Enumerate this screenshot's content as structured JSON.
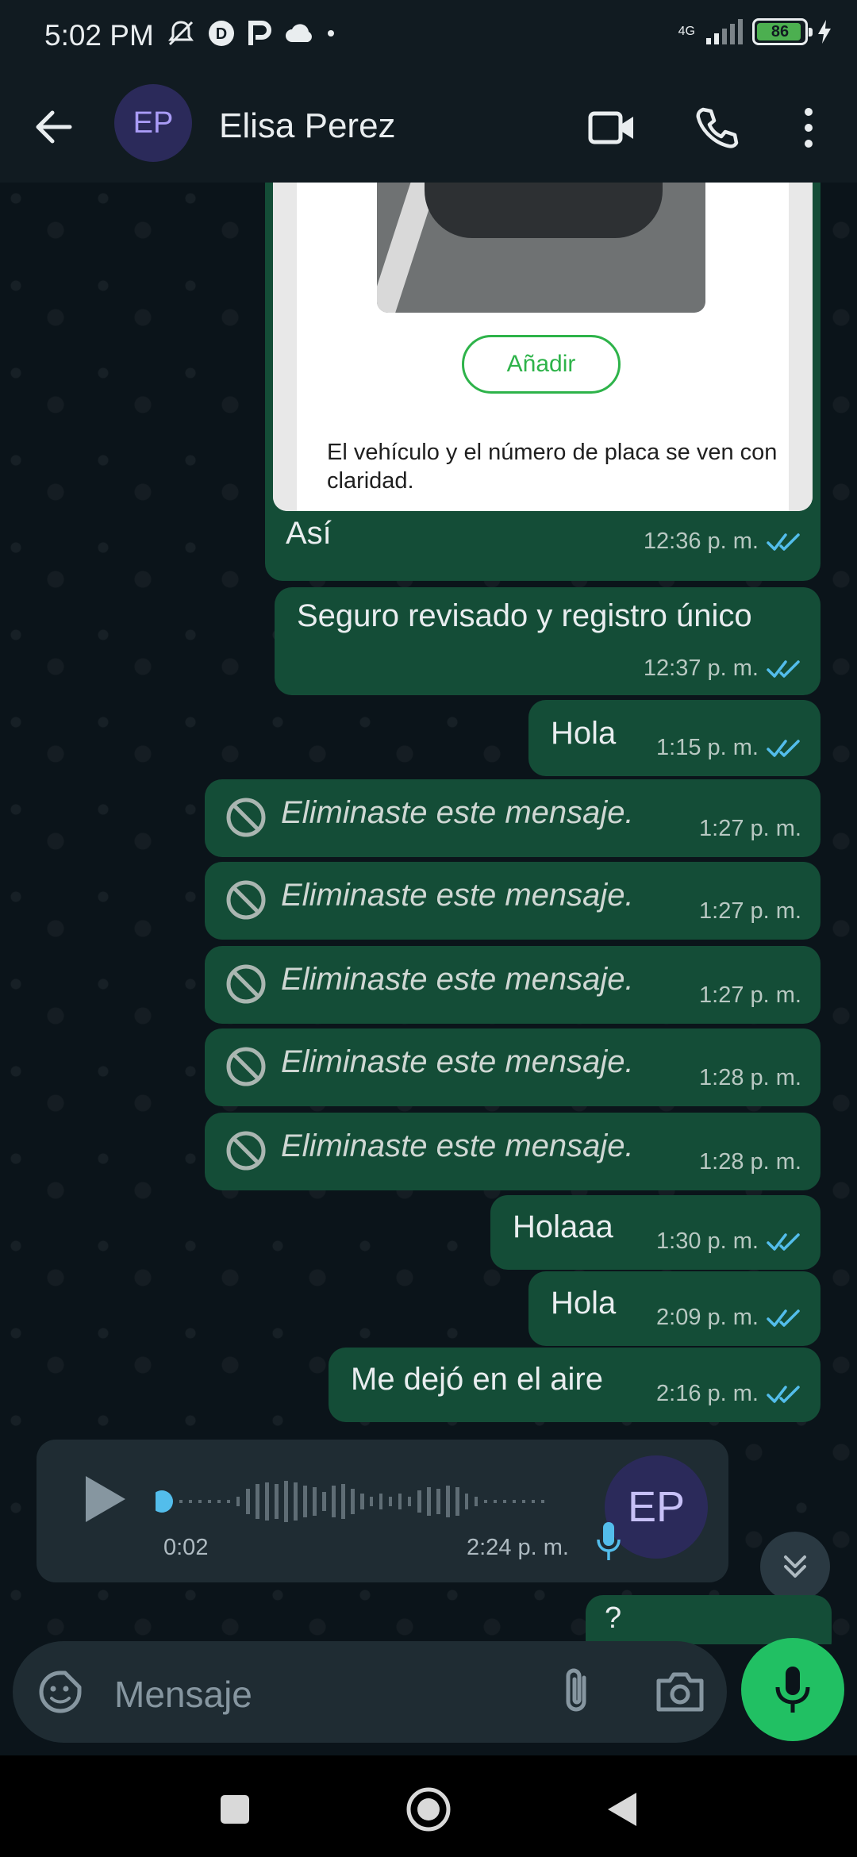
{
  "status_bar": {
    "time": "5:02 PM",
    "network": "4G",
    "battery": "86",
    "icons": [
      "mute-bell-icon",
      "d-icon",
      "p-icon",
      "cloud-icon",
      "dot-icon",
      "signal-icon",
      "battery-icon",
      "charging-icon"
    ]
  },
  "header": {
    "avatar_initials": "EP",
    "contact_name": "Elisa Perez",
    "icons": [
      "back-arrow-icon",
      "video-call-icon",
      "phone-call-icon",
      "more-vert-icon"
    ]
  },
  "card": {
    "button_label": "Añadir",
    "caption": "El vehículo y el número de placa se ven con claridad."
  },
  "messages": [
    {
      "text": "Así",
      "time": "12:36 p. m.",
      "read": true
    },
    {
      "text": "Seguro revisado y registro único",
      "time": "12:37 p. m.",
      "read": true
    },
    {
      "text": "Hola",
      "time": "1:15 p. m.",
      "read": true
    },
    {
      "text": "Eliminaste este mensaje.",
      "time": "1:27 p. m.",
      "deleted": true
    },
    {
      "text": "Eliminaste este mensaje.",
      "time": "1:27 p. m.",
      "deleted": true
    },
    {
      "text": "Eliminaste este mensaje.",
      "time": "1:27 p. m.",
      "deleted": true
    },
    {
      "text": "Eliminaste este mensaje.",
      "time": "1:28 p. m.",
      "deleted": true
    },
    {
      "text": "Eliminaste este mensaje.",
      "time": "1:28 p. m.",
      "deleted": true
    },
    {
      "text": "Holaaa",
      "time": "1:30 p. m.",
      "read": true
    },
    {
      "text": "Hola",
      "time": "2:09 p. m.",
      "read": true
    },
    {
      "text": "Me dejó en el aire",
      "time": "2:16 p. m.",
      "read": true
    },
    {
      "text": "?",
      "time": "",
      "partial": true
    }
  ],
  "voice_note": {
    "duration": "0:02",
    "time": "2:24 p. m.",
    "avatar_initials": "EP"
  },
  "input": {
    "placeholder": "Mensaje"
  },
  "colors": {
    "bubble_out": "#144d37",
    "header_bg": "#111b21",
    "accent_green": "#21c063",
    "read_ticks": "#53bdeb"
  }
}
